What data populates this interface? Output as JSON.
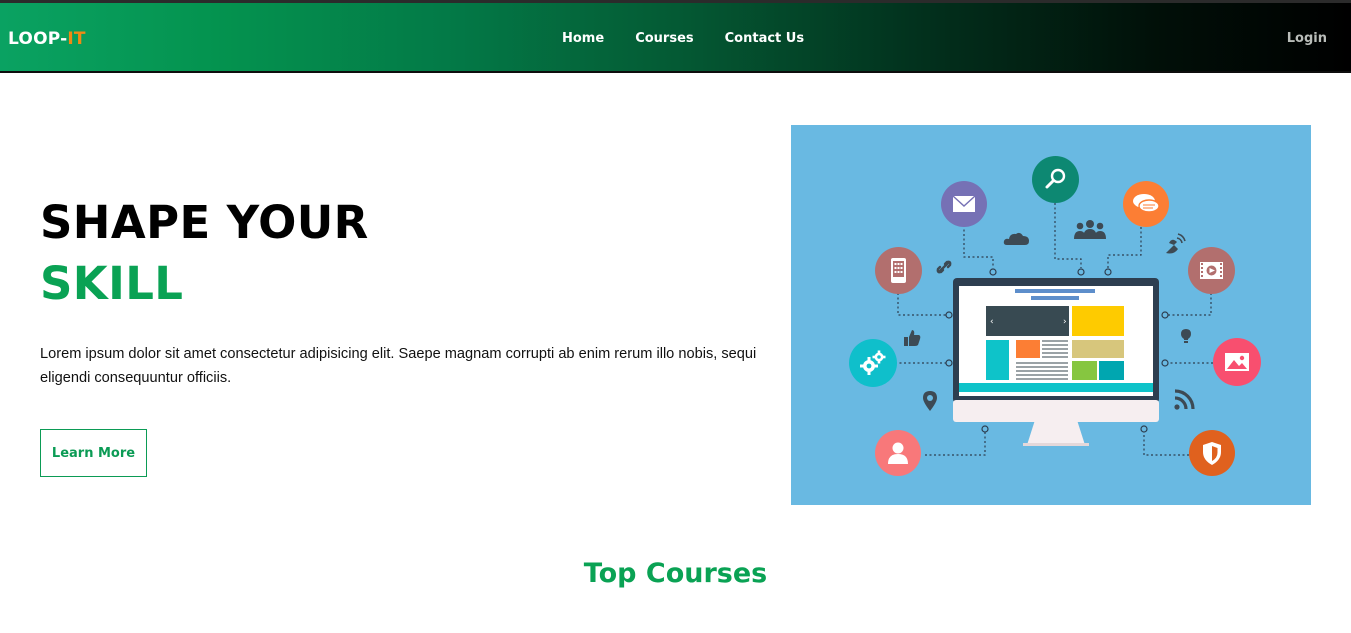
{
  "navbar": {
    "brand_main": "LOOP-",
    "brand_accent": "IT",
    "links": [
      {
        "label": "Home"
      },
      {
        "label": "Courses"
      },
      {
        "label": "Contact Us"
      }
    ],
    "login_label": "Login",
    "accent_color": "#f08a14"
  },
  "hero": {
    "title_line1": "SHAPE YOUR",
    "title_line2": "SKILL",
    "description": "Lorem ipsum dolor sit amet consectetur adipisicing elit. Saepe magnam corrupti ab enim rerum illo nobis, sequi eligendi consequuntur officiis.",
    "cta_label": "Learn More",
    "brand_color": "#0aa254",
    "illustration_bg": "#69b9e2"
  },
  "sections": {
    "top_courses_title": "Top Courses"
  },
  "illustration_icons": [
    "mail-icon",
    "search-icon",
    "chat-icon",
    "mobile-icon",
    "video-icon",
    "settings-icon",
    "image-icon",
    "user-icon",
    "shield-icon",
    "cloud-icon",
    "group-icon",
    "satellite-icon",
    "link-icon",
    "thumbs-up-icon",
    "lightbulb-icon",
    "location-pin-icon",
    "rss-icon",
    "monitor-icon"
  ]
}
